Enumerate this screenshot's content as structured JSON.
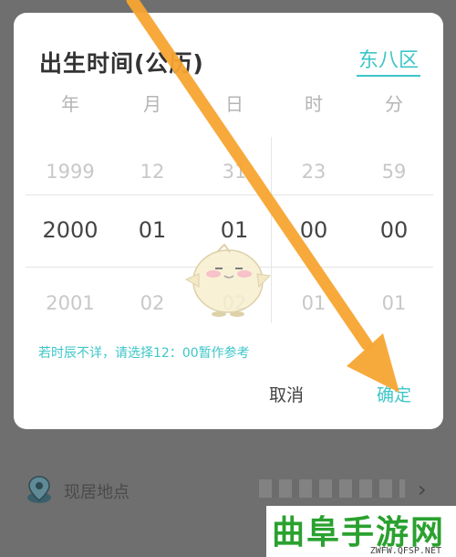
{
  "dialog": {
    "title": "出生时间(公历)",
    "timezone": "东八区",
    "columns": [
      "年",
      "月",
      "日",
      "时",
      "分"
    ],
    "rows": [
      [
        "1999",
        "12",
        "31",
        "23",
        "59"
      ],
      [
        "2000",
        "01",
        "01",
        "00",
        "00"
      ],
      [
        "2001",
        "02",
        "02",
        "01",
        "01"
      ]
    ],
    "selected_row": 1,
    "hint": "若时辰不详，请选择12：00暂作参考",
    "cancel_label": "取消",
    "ok_label": "确定"
  },
  "background": {
    "location_label": "现居地点"
  },
  "watermark": {
    "main": "曲阜手游网",
    "sub": "ZWFW.QFSP.NET"
  },
  "colors": {
    "accent": "#3ec6c8",
    "arrow": "#f7a531",
    "watermark_green": "#2aa12f"
  }
}
